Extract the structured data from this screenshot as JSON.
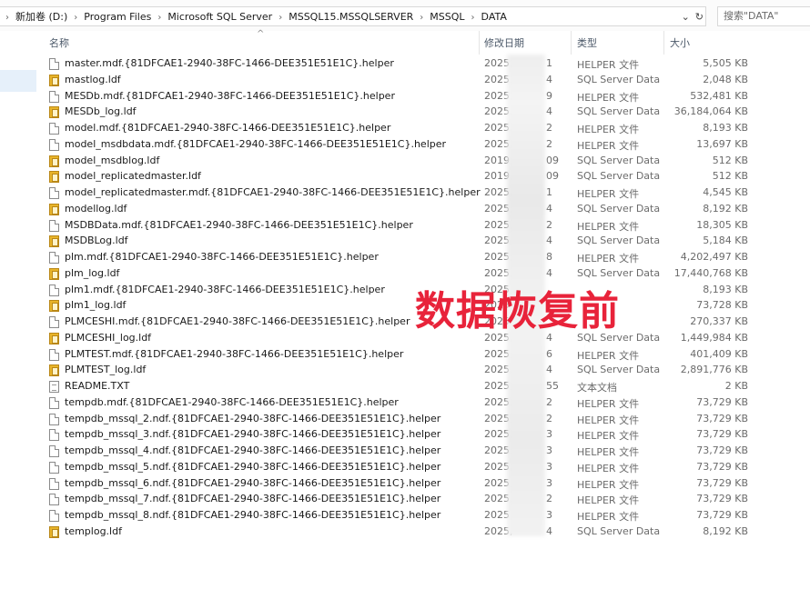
{
  "address_bar": {
    "path": [
      "新加卷 (D:)",
      "Program Files",
      "Microsoft SQL Server",
      "MSSQL15.MSSQLSERVER",
      "MSSQL",
      "DATA"
    ],
    "dropdown_icon": "chevron-down-icon",
    "refresh_icon": "refresh-icon",
    "search_placeholder": "搜索\"DATA\""
  },
  "columns": {
    "name": "名称",
    "date": "修改日期",
    "type": "类型",
    "size": "大小",
    "sort_glyph": "^"
  },
  "files": [
    {
      "icon": "doc",
      "name": "master.mdf.{81DFCAE1-2940-38FC-1466-DEE351E51E1C}.helper",
      "date": "2025,",
      "day": "1",
      "type": "HELPER 文件",
      "size": "5,505 KB"
    },
    {
      "icon": "ldf",
      "name": "mastlog.ldf",
      "date": "2025,",
      "day": "4",
      "type": "SQL Server Data...",
      "size": "2,048 KB"
    },
    {
      "icon": "doc",
      "name": "MESDb.mdf.{81DFCAE1-2940-38FC-1466-DEE351E51E1C}.helper",
      "date": "2025,",
      "day": "9",
      "type": "HELPER 文件",
      "size": "532,481 KB"
    },
    {
      "icon": "ldf",
      "name": "MESDb_log.ldf",
      "date": "2025,",
      "day": "4",
      "type": "SQL Server Data...",
      "size": "36,184,064 KB"
    },
    {
      "icon": "doc",
      "name": "model.mdf.{81DFCAE1-2940-38FC-1466-DEE351E51E1C}.helper",
      "date": "2025,",
      "day": "2",
      "type": "HELPER 文件",
      "size": "8,193 KB"
    },
    {
      "icon": "doc",
      "name": "model_msdbdata.mdf.{81DFCAE1-2940-38FC-1466-DEE351E51E1C}.helper",
      "date": "2025,",
      "day": "2",
      "type": "HELPER 文件",
      "size": "13,697 KB"
    },
    {
      "icon": "ldf",
      "name": "model_msdblog.ldf",
      "date": "2019,",
      "day": "09",
      "type": "SQL Server Data...",
      "size": "512 KB"
    },
    {
      "icon": "ldf",
      "name": "model_replicatedmaster.ldf",
      "date": "2019,",
      "day": "09",
      "type": "SQL Server Data...",
      "size": "512 KB"
    },
    {
      "icon": "doc",
      "name": "model_replicatedmaster.mdf.{81DFCAE1-2940-38FC-1466-DEE351E51E1C}.helper",
      "date": "2025,",
      "day": "1",
      "type": "HELPER 文件",
      "size": "4,545 KB"
    },
    {
      "icon": "ldf",
      "name": "modellog.ldf",
      "date": "2025,",
      "day": "4",
      "type": "SQL Server Data...",
      "size": "8,192 KB"
    },
    {
      "icon": "doc",
      "name": "MSDBData.mdf.{81DFCAE1-2940-38FC-1466-DEE351E51E1C}.helper",
      "date": "2025,",
      "day": "2",
      "type": "HELPER 文件",
      "size": "18,305 KB"
    },
    {
      "icon": "ldf",
      "name": "MSDBLog.ldf",
      "date": "2025,",
      "day": "4",
      "type": "SQL Server Data...",
      "size": "5,184 KB"
    },
    {
      "icon": "doc",
      "name": "plm.mdf.{81DFCAE1-2940-38FC-1466-DEE351E51E1C}.helper",
      "date": "2025,",
      "day": "8",
      "type": "HELPER 文件",
      "size": "4,202,497 KB"
    },
    {
      "icon": "ldf",
      "name": "plm_log.ldf",
      "date": "2025,",
      "day": "4",
      "type": "SQL Server Data...",
      "size": "17,440,768 KB"
    },
    {
      "icon": "doc",
      "name": "plm1.mdf.{81DFCAE1-2940-38FC-1466-DEE351E51E1C}.helper",
      "date": "2025,",
      "day": "",
      "type": "",
      "size": "8,193 KB"
    },
    {
      "icon": "ldf",
      "name": "plm1_log.ldf",
      "date": "2025,",
      "day": "",
      "type": "",
      "size": "73,728 KB"
    },
    {
      "icon": "doc",
      "name": "PLMCESHI.mdf.{81DFCAE1-2940-38FC-1466-DEE351E51E1C}.helper",
      "date": "2025,",
      "day": "",
      "type": "",
      "size": "270,337 KB"
    },
    {
      "icon": "ldf",
      "name": "PLMCESHI_log.ldf",
      "date": "2025,",
      "day": "4",
      "type": "SQL Server Data...",
      "size": "1,449,984 KB"
    },
    {
      "icon": "doc",
      "name": "PLMTEST.mdf.{81DFCAE1-2940-38FC-1466-DEE351E51E1C}.helper",
      "date": "2025,",
      "day": "6",
      "type": "HELPER 文件",
      "size": "401,409 KB"
    },
    {
      "icon": "ldf",
      "name": "PLMTEST_log.ldf",
      "date": "2025,",
      "day": "4",
      "type": "SQL Server Data...",
      "size": "2,891,776 KB"
    },
    {
      "icon": "txt",
      "name": "README.TXT",
      "date": "2025,",
      "day": "55",
      "type": "文本文档",
      "size": "2 KB"
    },
    {
      "icon": "doc",
      "name": "tempdb.mdf.{81DFCAE1-2940-38FC-1466-DEE351E51E1C}.helper",
      "date": "2025,",
      "day": "2",
      "type": "HELPER 文件",
      "size": "73,729 KB"
    },
    {
      "icon": "doc",
      "name": "tempdb_mssql_2.ndf.{81DFCAE1-2940-38FC-1466-DEE351E51E1C}.helper",
      "date": "2025,",
      "day": "2",
      "type": "HELPER 文件",
      "size": "73,729 KB"
    },
    {
      "icon": "doc",
      "name": "tempdb_mssql_3.ndf.{81DFCAE1-2940-38FC-1466-DEE351E51E1C}.helper",
      "date": "2025,",
      "day": "3",
      "type": "HELPER 文件",
      "size": "73,729 KB"
    },
    {
      "icon": "doc",
      "name": "tempdb_mssql_4.ndf.{81DFCAE1-2940-38FC-1466-DEE351E51E1C}.helper",
      "date": "2025,",
      "day": "3",
      "type": "HELPER 文件",
      "size": "73,729 KB"
    },
    {
      "icon": "doc",
      "name": "tempdb_mssql_5.ndf.{81DFCAE1-2940-38FC-1466-DEE351E51E1C}.helper",
      "date": "2025,",
      "day": "3",
      "type": "HELPER 文件",
      "size": "73,729 KB"
    },
    {
      "icon": "doc",
      "name": "tempdb_mssql_6.ndf.{81DFCAE1-2940-38FC-1466-DEE351E51E1C}.helper",
      "date": "2025,",
      "day": "3",
      "type": "HELPER 文件",
      "size": "73,729 KB"
    },
    {
      "icon": "doc",
      "name": "tempdb_mssql_7.ndf.{81DFCAE1-2940-38FC-1466-DEE351E51E1C}.helper",
      "date": "2025,",
      "day": "2",
      "type": "HELPER 文件",
      "size": "73,729 KB"
    },
    {
      "icon": "doc",
      "name": "tempdb_mssql_8.ndf.{81DFCAE1-2940-38FC-1466-DEE351E51E1C}.helper",
      "date": "2025,",
      "day": "3",
      "type": "HELPER 文件",
      "size": "73,729 KB"
    },
    {
      "icon": "ldf",
      "name": "templog.ldf",
      "date": "2025,",
      "day": "4",
      "type": "SQL Server Data...",
      "size": "8,192 KB"
    }
  ],
  "overlay": {
    "text": "数据恢复前",
    "color": "#e8233a"
  }
}
